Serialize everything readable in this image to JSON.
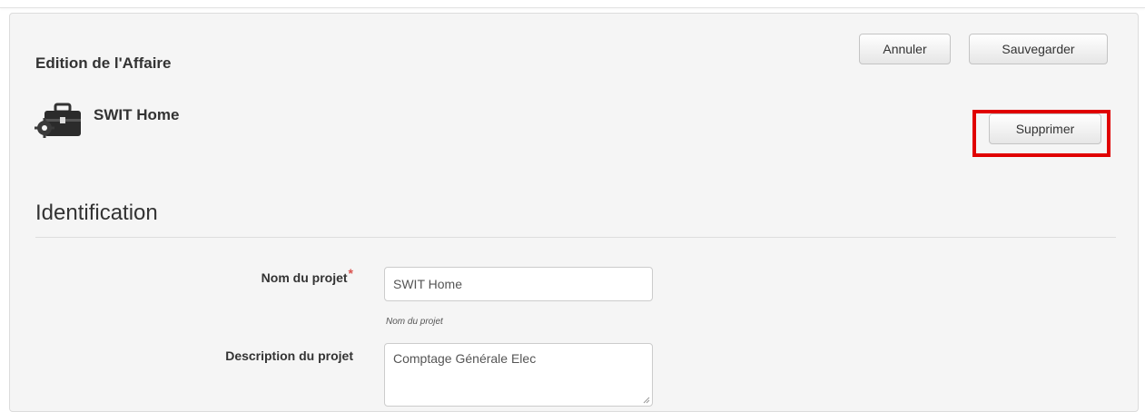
{
  "header": {
    "title": "Edition de l'Affaire"
  },
  "toolbar": {
    "cancel_label": "Annuler",
    "save_label": "Sauvegarder",
    "delete_label": "Supprimer"
  },
  "record": {
    "icon": "briefcase-icon",
    "name": "SWIT Home"
  },
  "section": {
    "title": "Identification"
  },
  "form": {
    "project_name": {
      "label": "Nom du projet",
      "required_mark": "*",
      "value": "SWIT Home",
      "help": "Nom du projet"
    },
    "project_description": {
      "label": "Description du projet",
      "value": "Comptage Générale Elec"
    }
  },
  "colors": {
    "highlight": "#e00000",
    "required": "#d9534f",
    "panel_background": "#f5f5f5"
  }
}
